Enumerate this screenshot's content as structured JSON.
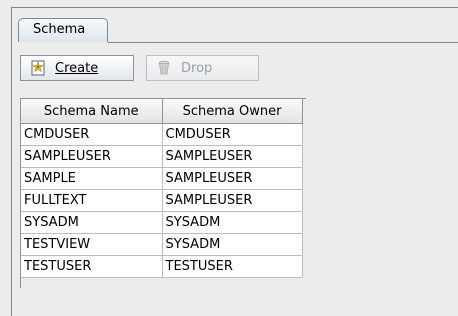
{
  "tabs": [
    {
      "label": "Schema"
    }
  ],
  "toolbar": {
    "create_label": "Create",
    "drop_label": "Drop"
  },
  "table": {
    "columns": [
      "Schema Name",
      "Schema Owner"
    ],
    "rows": [
      [
        "CMDUSER",
        "CMDUSER"
      ],
      [
        "SAMPLEUSER",
        "SAMPLEUSER"
      ],
      [
        "SAMPLE",
        "SAMPLEUSER"
      ],
      [
        "FULLTEXT",
        "SAMPLEUSER"
      ],
      [
        "SYSADM",
        "SYSADM"
      ],
      [
        "TESTVIEW",
        "SYSADM"
      ],
      [
        "TESTUSER",
        "TESTUSER"
      ]
    ]
  },
  "icons": {
    "create": "new-star-icon",
    "drop": "trash-bin-icon"
  },
  "colors": {
    "border": "#7a8a99",
    "disabled_text": "#9aa3ab"
  }
}
